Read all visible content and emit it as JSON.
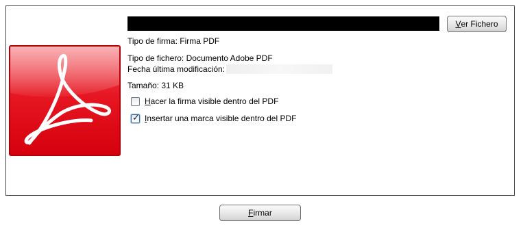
{
  "panel": {
    "logo_icon": "adobe-pdf-icon",
    "filename": "",
    "view_button": {
      "mnemonic": "V",
      "rest": "er Fichero"
    },
    "signature_type": "Tipo de firma: Firma PDF",
    "file_type": "Tipo de fichero: Documento Adobe PDF",
    "last_modified_label": "Fecha última modificación:",
    "last_modified_value": "",
    "size": "Tamaño: 31 KB",
    "options": [
      {
        "mnemonic": "H",
        "rest": "acer la firma visible dentro del PDF",
        "checked": false
      },
      {
        "mnemonic": "I",
        "rest": "nsertar una marca visible dentro del PDF",
        "checked": true
      }
    ]
  },
  "footer": {
    "sign_button": {
      "mnemonic": "F",
      "rest": "irmar"
    }
  },
  "colors": {
    "logo_red": "#e8141f",
    "logo_dark_red": "#b5000c",
    "panel_border": "#3c3c3c",
    "checkbox_accent": "#3d6fa3"
  }
}
